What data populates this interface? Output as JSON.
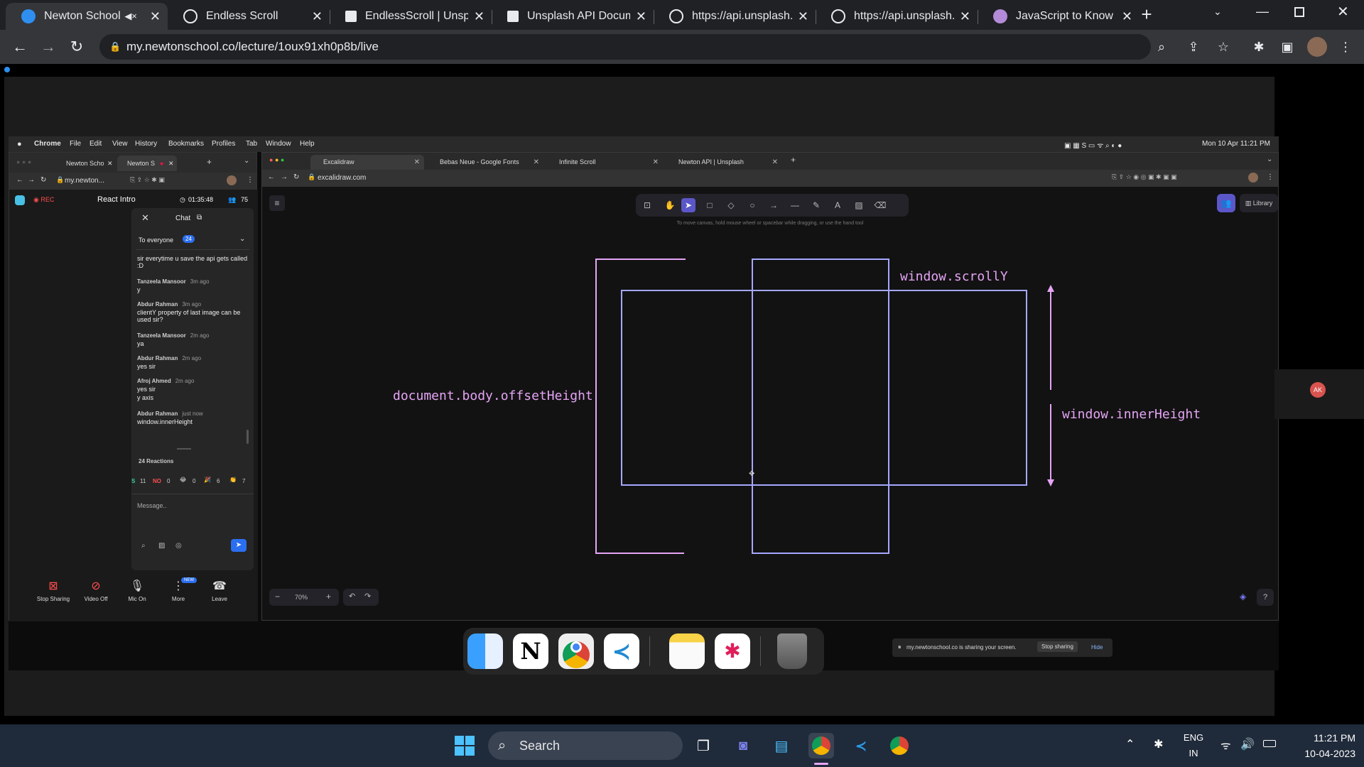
{
  "browser": {
    "tabs": [
      {
        "label": "Newton School",
        "active": true
      },
      {
        "label": "Endless Scroll"
      },
      {
        "label": "EndlessScroll | Unspla"
      },
      {
        "label": "Unsplash API Docume"
      },
      {
        "label": "https://api.unsplash.c"
      },
      {
        "label": "https://api.unsplash.c"
      },
      {
        "label": "JavaScript to Know fo"
      }
    ],
    "url": "my.newtonschool.co/lecture/1oux91xh0p8b/live"
  },
  "mac": {
    "menu": [
      "Chrome",
      "File",
      "Edit",
      "View",
      "History",
      "Bookmarks",
      "Profiles",
      "Tab",
      "Window",
      "Help"
    ],
    "datetime": "Mon 10 Apr  11:21 PM"
  },
  "left_browser": {
    "tabs": [
      "Newton Scho",
      "Newton S"
    ],
    "url": "my.newton...",
    "rec": "REC",
    "title": "React Intro",
    "timer": "01:35:48",
    "participants": "75"
  },
  "chat": {
    "title": "Chat",
    "to": "To everyone",
    "to_count": "24",
    "messages": [
      {
        "name": "",
        "time": "",
        "text": "sir everytime u save the api gets called :D"
      },
      {
        "name": "Tanzeela Mansoor",
        "time": "3m ago",
        "text": "y"
      },
      {
        "name": "Abdur Rahman",
        "time": "3m ago",
        "text": "clientY property of last image can be used sir?"
      },
      {
        "name": "Tanzeela Mansoor",
        "time": "2m ago",
        "text": "ya"
      },
      {
        "name": "Abdur Rahman",
        "time": "2m ago",
        "text": "yes sir"
      },
      {
        "name": "Afroj Ahmed",
        "time": "2m ago",
        "text": "yes sir"
      },
      {
        "name": "",
        "time": "",
        "text": "y axis"
      },
      {
        "name": "Abdur Rahman",
        "time": "just now",
        "text": "window.innerHeight"
      }
    ],
    "reactions_label": "24 Reactions",
    "reactions": [
      {
        "emoji": "S",
        "count": "11"
      },
      {
        "emoji": "NO",
        "count": "0"
      },
      {
        "emoji": "😂",
        "count": "0"
      },
      {
        "emoji": "🎉",
        "count": "6"
      },
      {
        "emoji": "👏",
        "count": "7"
      }
    ],
    "placeholder": "Message.."
  },
  "zoom_controls": [
    {
      "label": "Stop Sharing",
      "icon": "stop-share-icon"
    },
    {
      "label": "Video Off",
      "icon": "video-off-icon"
    },
    {
      "label": "Mic On",
      "icon": "mic-icon"
    },
    {
      "label": "More",
      "icon": "more-icon",
      "badge": "NEW"
    },
    {
      "label": "Leave",
      "icon": "leave-icon"
    }
  ],
  "right_browser": {
    "tabs": [
      "Excalidraw",
      "Bebas Neue - Google Fonts",
      "Infinite Scroll",
      "Newton API | Unsplash"
    ],
    "url": "excalidraw.com"
  },
  "excalidraw": {
    "hint": "To move canvas, hold mouse wheel or spacebar while dragging, or use the hand tool",
    "library": "Library",
    "zoom": "70%",
    "labels": {
      "offset": "document.body.offsetHeight",
      "scrolly": "window.scrollY",
      "inner": "window.innerHeight"
    },
    "colors": {
      "pink": "#e5a4f5",
      "blue": "#a5a8ff"
    }
  },
  "share_bar": {
    "text": "my.newtonschool.co is sharing your screen.",
    "stop": "Stop sharing",
    "hide": "Hide"
  },
  "participant": {
    "initials": "AK"
  },
  "taskbar": {
    "search": "Search",
    "lang1": "ENG",
    "lang2": "IN",
    "time": "11:21 PM",
    "date": "10-04-2023"
  }
}
